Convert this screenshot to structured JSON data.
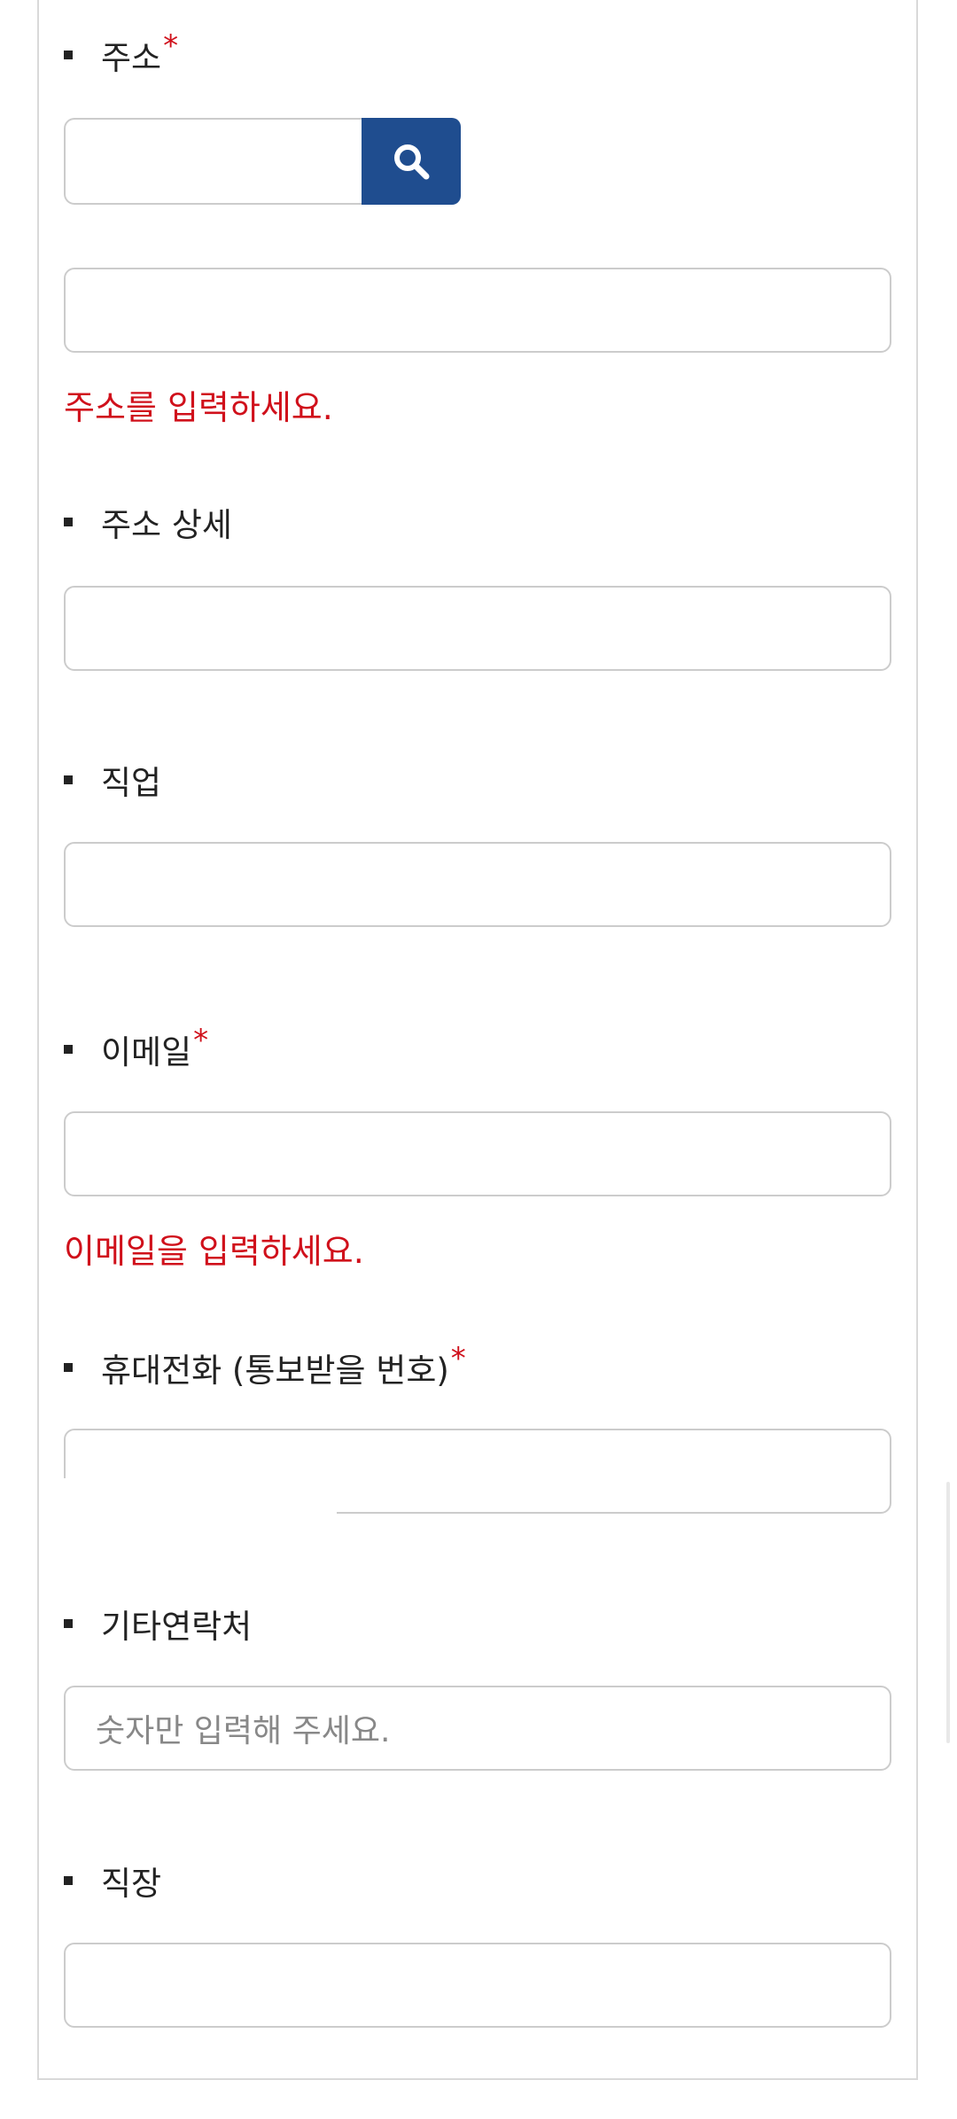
{
  "address": {
    "label": "주소",
    "required_mark": "*",
    "error": "주소를 입력하세요."
  },
  "address_detail": {
    "label": "주소 상세"
  },
  "job": {
    "label": "직업"
  },
  "email": {
    "label": "이메일",
    "required_mark": "*",
    "error": "이메일을 입력하세요."
  },
  "mobile": {
    "label": "휴대전화 (통보받을 번호)",
    "required_mark": "*"
  },
  "other_contact": {
    "label": "기타연락처",
    "placeholder": "숫자만 입력해 주세요."
  },
  "workplace": {
    "label": "직장"
  },
  "icons": {
    "search": "search-icon"
  },
  "colors": {
    "accent": "#1f4d8f",
    "error": "#d0101b",
    "border": "#cccccc"
  }
}
